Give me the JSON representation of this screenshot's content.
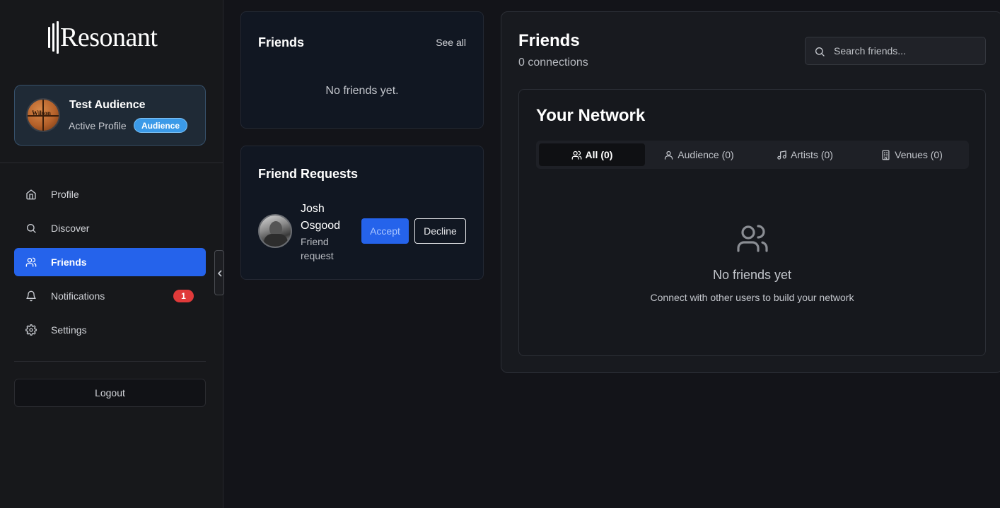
{
  "app": {
    "name": "Resonant"
  },
  "profile": {
    "name": "Test Audience",
    "status": "Active Profile",
    "badge": "Audience"
  },
  "sidebar": {
    "items": [
      {
        "label": "Profile",
        "icon": "home-icon"
      },
      {
        "label": "Discover",
        "icon": "search-icon"
      },
      {
        "label": "Friends",
        "icon": "users-icon",
        "active": true
      },
      {
        "label": "Notifications",
        "icon": "bell-icon",
        "badge": "1"
      },
      {
        "label": "Settings",
        "icon": "gear-icon"
      }
    ],
    "logout_label": "Logout"
  },
  "friends_card": {
    "title": "Friends",
    "see_all": "See all",
    "empty": "No friends yet."
  },
  "requests_card": {
    "title": "Friend Requests",
    "requests": [
      {
        "name": "Josh Osgood",
        "subtitle": "Friend request",
        "accept_label": "Accept",
        "decline_label": "Decline"
      }
    ]
  },
  "main": {
    "title": "Friends",
    "connections": "0 connections",
    "search_placeholder": "Search friends...",
    "network": {
      "title": "Your Network",
      "tabs": [
        {
          "label": "All (0)",
          "icon": "users-icon",
          "active": true
        },
        {
          "label": "Audience (0)",
          "icon": "user-icon"
        },
        {
          "label": "Artists (0)",
          "icon": "music-note-icon"
        },
        {
          "label": "Venues (0)",
          "icon": "building-icon"
        }
      ],
      "empty_title": "No friends yet",
      "empty_desc": "Connect with other users to build your network"
    }
  },
  "colors": {
    "accent": "#2563eb",
    "badge_audience": "#3b9ae8",
    "notif_badge": "#e03a3a"
  }
}
